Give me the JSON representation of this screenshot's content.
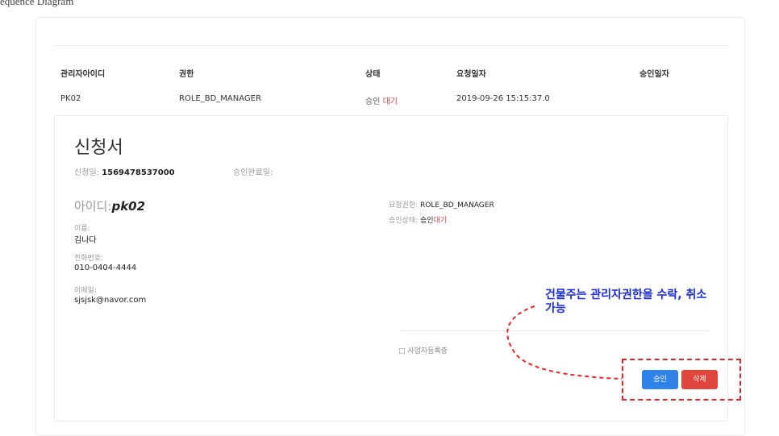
{
  "caption": "equence Diagram",
  "table": {
    "headers": [
      "관리자아이디",
      "권한",
      "상태",
      "요청일자",
      "승인일자"
    ],
    "row": {
      "admin_id": "PK02",
      "role": "ROLE_BD_MANAGER",
      "status_prefix": "승인 ",
      "status_suffix": "대기",
      "requested_at": "2019-09-26 15:15:37.0",
      "approved_at": ""
    }
  },
  "application": {
    "title": "신청서",
    "apply_date_label": "신청일: ",
    "apply_date_value": "1569478537000",
    "approve_done_label": "승인완료일:",
    "approve_done_value": "",
    "userid_label": "아이디:",
    "userid_value": "pk02",
    "name_label": "이름:",
    "name_value": "김나다",
    "phone_label": "전화번호:",
    "phone_value": "010-0404-4444",
    "email_label": "이메일:",
    "email_value": "sjsjsk@navor.com",
    "req_role_label": "요청권한: ",
    "req_role_value": "ROLE_BD_MANAGER",
    "approve_status_label": "승인상태: ",
    "approve_status_prefix": "승인",
    "approve_status_suffix": "대기",
    "attachment": "□ 사업자등록증"
  },
  "buttons": {
    "approve": "승인",
    "delete": "삭제"
  },
  "annotation": {
    "line1": "건물주는 관리자권한을 수락, 취소",
    "line2": "가능"
  },
  "colors": {
    "approve_button": "#2f82e8",
    "delete_button": "#e0463e",
    "annotation_text": "#1b2bd8",
    "annotation_dash": "#e8242d"
  }
}
